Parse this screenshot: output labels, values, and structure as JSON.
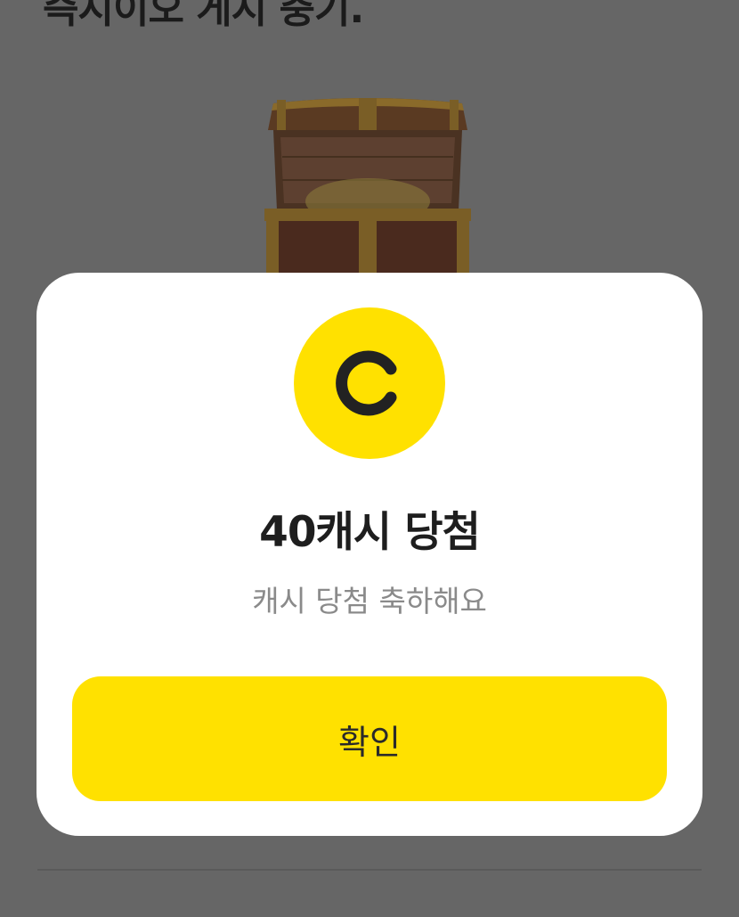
{
  "background": {
    "title_partial": "즉시이오 게시 충기.",
    "chest_icon": "treasure-chest-icon"
  },
  "dialog": {
    "coin_icon": "cash-coin-icon",
    "coin_letter": "C",
    "title": "40캐시 당첨",
    "message": "캐시 당첨 축하해요",
    "confirm_label": "확인"
  },
  "colors": {
    "accent": "#ffe100",
    "overlay": "#666666",
    "title": "#1e1e1e",
    "message": "#8a8a8a"
  }
}
